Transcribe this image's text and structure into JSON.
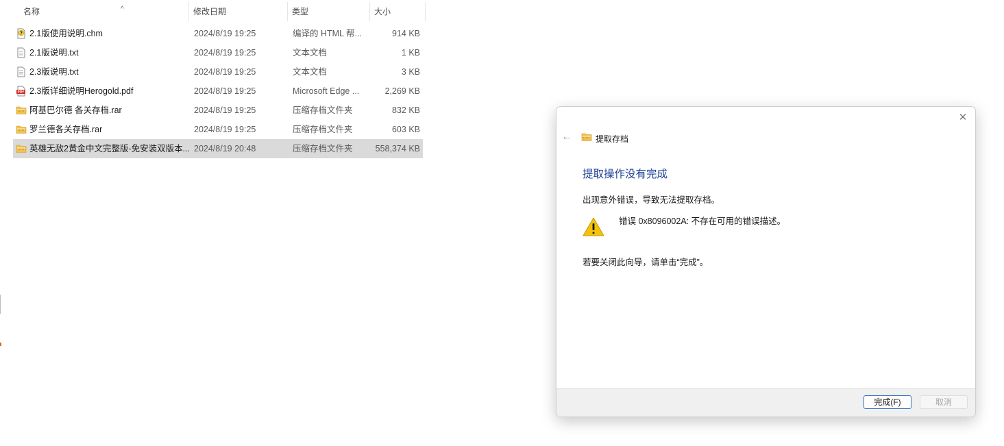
{
  "columns": {
    "name": "名称",
    "date": "修改日期",
    "type": "类型",
    "size": "大小",
    "sort_indicator": "^"
  },
  "files": [
    {
      "icon": "help-file-icon",
      "name": "2.1版使用说明.chm",
      "date": "2024/8/19 19:25",
      "type": "编译的 HTML 帮...",
      "size": "914 KB"
    },
    {
      "icon": "text-file-icon",
      "name": "2.1版说明.txt",
      "date": "2024/8/19 19:25",
      "type": "文本文档",
      "size": "1 KB"
    },
    {
      "icon": "text-file-icon",
      "name": "2.3版说明.txt",
      "date": "2024/8/19 19:25",
      "type": "文本文档",
      "size": "3 KB"
    },
    {
      "icon": "pdf-file-icon",
      "name": "2.3版详细说明Herogold.pdf",
      "date": "2024/8/19 19:25",
      "type": "Microsoft Edge ...",
      "size": "2,269 KB"
    },
    {
      "icon": "zip-folder-icon",
      "name": "阿基巴尔德 各关存档.rar",
      "date": "2024/8/19 19:25",
      "type": "压缩存档文件夹",
      "size": "832 KB"
    },
    {
      "icon": "zip-folder-icon",
      "name": "罗兰德各关存档.rar",
      "date": "2024/8/19 19:25",
      "type": "压缩存档文件夹",
      "size": "603 KB"
    },
    {
      "icon": "zip-folder-icon",
      "name": "英雄无敌2黄金中文完整版-免安装双版本...",
      "date": "2024/8/19 20:48",
      "type": "压缩存档文件夹",
      "size": "558,374 KB",
      "selected": true
    }
  ],
  "dialog": {
    "close_glyph": "✕",
    "back_glyph": "←",
    "wizard_title": "提取存档",
    "heading": "提取操作没有完成",
    "message": "出现意外错误，导致无法提取存档。",
    "error": "错误 0x8096002A: 不存在可用的错误描述。",
    "instruction": "若要关闭此向导，请单击“完成”。",
    "finish_label": "完成(F)",
    "cancel_label": "取消"
  },
  "colors": {
    "heading": "#1c3f94",
    "selected_row": "#dadada",
    "finish_border": "#2f6fbf",
    "folder": "#f2c14e",
    "warning": "#f4c20d"
  }
}
